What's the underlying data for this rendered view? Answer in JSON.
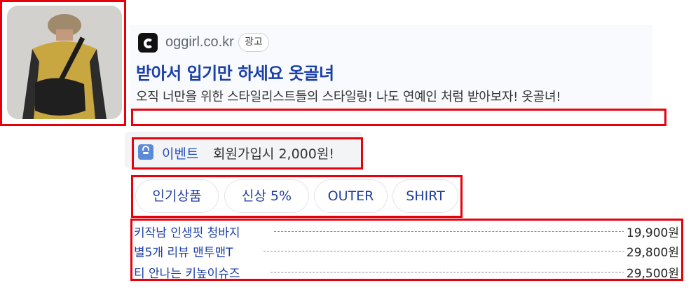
{
  "ad": {
    "domain": "oggirl.co.kr",
    "badge": "광고",
    "title": "받아서 입기만 하세요 옷골녀",
    "description": "오직 너만을 위한 스타일리스트들의 스타일링! 나도 연예인 처럼 받아보자! 옷골녀!"
  },
  "event": {
    "label": "이벤트",
    "text": "회원가입시 2,000원!"
  },
  "chips": [
    "인기상품",
    "신상 5%",
    "OUTER",
    "SHIRT"
  ],
  "products": [
    {
      "name": "키작남 인생핏 청바지",
      "price": "19,900원"
    },
    {
      "name": "별5개 리뷰 맨투맨T",
      "price": "29,800원"
    },
    {
      "name": "티 안나는 키높이슈즈",
      "price": "29,500원"
    }
  ],
  "colors": {
    "highlight_border": "#e8000b",
    "link_blue": "#1a3fa8",
    "event_blue": "#2550c7"
  },
  "icons": [
    "site-logo-icon",
    "shopping-bag-icon"
  ]
}
